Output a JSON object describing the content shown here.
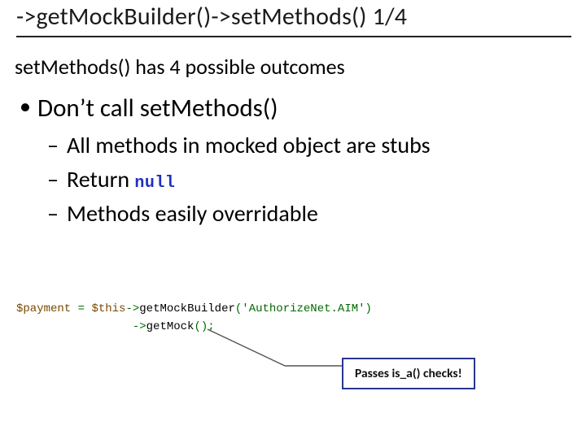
{
  "title": "->getMockBuilder()->setMethods() 1/4",
  "intro": "setMethods() has 4 possible outcomes",
  "bullet1": "Don’t call setMethods()",
  "sub1": "All methods in mocked object are stubs",
  "sub2_prefix": "Return ",
  "sub2_null": "null",
  "sub3": "Methods easily overridable",
  "code": {
    "var": "$payment",
    "assign": " = ",
    "this": "$this",
    "arrow1": "->",
    "fn1": "getMockBuilder",
    "paren_open": "(",
    "arg_str": "'AuthorizeNet.AIM'",
    "paren_close": ")",
    "indent": "                 ",
    "arrow2": "->",
    "fn2": "getMock",
    "call2_tail": "();"
  },
  "callout": "Passes is_a() checks!"
}
